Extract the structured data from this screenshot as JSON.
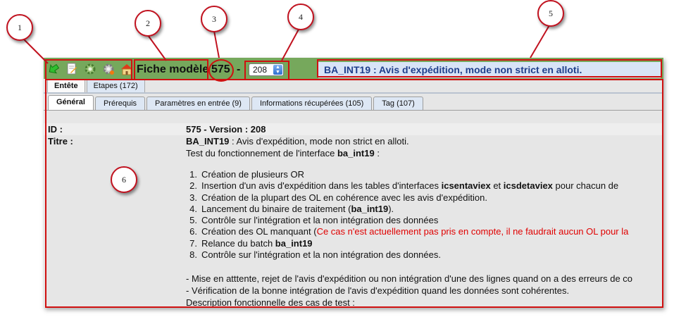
{
  "callouts": [
    "1",
    "2",
    "3",
    "4",
    "5",
    "6"
  ],
  "toolbar": {
    "icons": [
      "back-arrow-icon",
      "edit-document-icon",
      "gear-green-icon",
      "gear-orange-icon",
      "home-icon"
    ],
    "fiche_label": "Fiche modèle",
    "fiche_number": "575",
    "separator": "-",
    "version_value": "208"
  },
  "banner": {
    "title": "BA_INT19 : Avis d'expédition, mode non strict en alloti."
  },
  "outer_tabs": [
    {
      "label": "Entête"
    },
    {
      "label": "Etapes (172)"
    }
  ],
  "inner_tabs": [
    {
      "label": "Général"
    },
    {
      "label": "Prérequis"
    },
    {
      "label": "Paramètres en entrée (9)"
    },
    {
      "label": "Informations récupérées (105)"
    },
    {
      "label": "Tag (107)"
    }
  ],
  "content": {
    "id_label": "ID :",
    "id_value": "575 - Version : 208",
    "titre_label": "Titre :",
    "titre_code": "BA_INT19",
    "titre_rest": " : Avis d'expédition, mode non strict en alloti.",
    "test_intro": "Test du fonctionnement de l'interface ",
    "test_intro_bold": "ba_int19",
    "test_intro_end": " :",
    "steps": [
      {
        "num": "1.",
        "a": "Création de plusieurs OR"
      },
      {
        "num": "2.",
        "a": "Insertion d'un avis d'expédition dans les tables d'interfaces ",
        "b1": "icsentaviex",
        "c": " et ",
        "b2": "icsdetaviex",
        "d": " pour chacun de"
      },
      {
        "num": "3.",
        "a": "Création de la plupart des OL en cohérence avec les avis d'expédition."
      },
      {
        "num": "4.",
        "a": "Lancement du binaire de traitement (",
        "b1": "ba_int19",
        "c": ")."
      },
      {
        "num": "5.",
        "a": "Contrôle sur l'intégration et la non intégration des données"
      },
      {
        "num": "6.",
        "a": "Création des OL manquant (",
        "red": "Ce cas n'est actuellement pas pris en compte, il ne faudrait aucun OL pour la"
      },
      {
        "num": "7.",
        "a": "Relance du batch ",
        "b1": "ba_int19"
      },
      {
        "num": "8.",
        "a": "Contrôle sur l'intégration et la non intégration des données."
      }
    ],
    "notes": [
      "- Mise en atttente, rejet de l'avis d'expédition ou non intégration d'une des lignes quand on a des erreurs de co",
      "- Vérification de la bonne intégration de l'avis d'expédition quand les données sont cohérentes.",
      "Description fonctionnelle des cas de test :"
    ]
  }
}
